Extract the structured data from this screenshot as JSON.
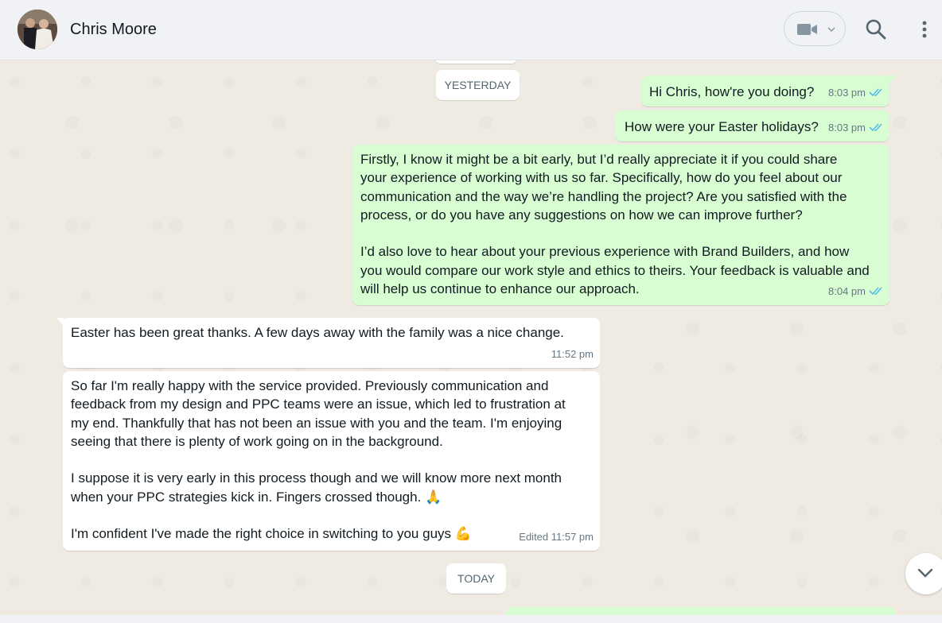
{
  "header": {
    "contact_name": "Chris Moore",
    "icons": [
      "video-camera-icon",
      "chevron-down-icon",
      "search-icon",
      "more-vertical-icon"
    ]
  },
  "chat": {
    "day_labels": {
      "yesterday": "YESTERDAY",
      "today": "TODAY"
    },
    "messages": [
      {
        "direction": "outgoing",
        "text": "Hi Chris, how're you doing?",
        "time": "8:03 pm",
        "status": "read"
      },
      {
        "direction": "outgoing",
        "text": "How were your Easter holidays?",
        "time": "8:03 pm",
        "status": "read"
      },
      {
        "direction": "outgoing",
        "text": "Firstly, I know it might be a bit early, but I’d really appreciate it if you could share\nyour experience of working with us so far. Specifically, how do you feel about our\ncommunication and the way we’re handling the project? Are you satisfied with the\nprocess, or do you have any suggestions on how we can improve further?\n\nI’d also love to hear about your previous experience with Brand Builders, and how\nyou would compare our work style and ethics to theirs. Your feedback is valuable and\nwill help us continue to enhance our approach.",
        "time": "8:04 pm",
        "status": "read"
      },
      {
        "direction": "incoming",
        "text": "Easter has been great thanks. A few days away with the family was a nice change.",
        "time": "11:52 pm"
      },
      {
        "direction": "incoming",
        "text": "So far I'm really happy with the service provided. Previously communication and\nfeedback from my design and PPC teams were an issue, which led to frustration at\nmy end. Thankfully that has not been an issue with you and the team. I'm enjoying\nseeing that there is plenty of work going on in the background.\n\nI suppose it is very early in this process though and we will know more next month\nwhen your PPC strategies kick in. Fingers crossed though. 🙏\n\nI'm confident I've made the right choice in switching to you guys 💪",
        "time": "Edited 11:57 pm"
      }
    ]
  },
  "colors": {
    "outgoing_bubble": "#d9fdd3",
    "incoming_bubble": "#ffffff",
    "read_ticks": "#53bdeb",
    "chat_background": "#efeae2"
  }
}
